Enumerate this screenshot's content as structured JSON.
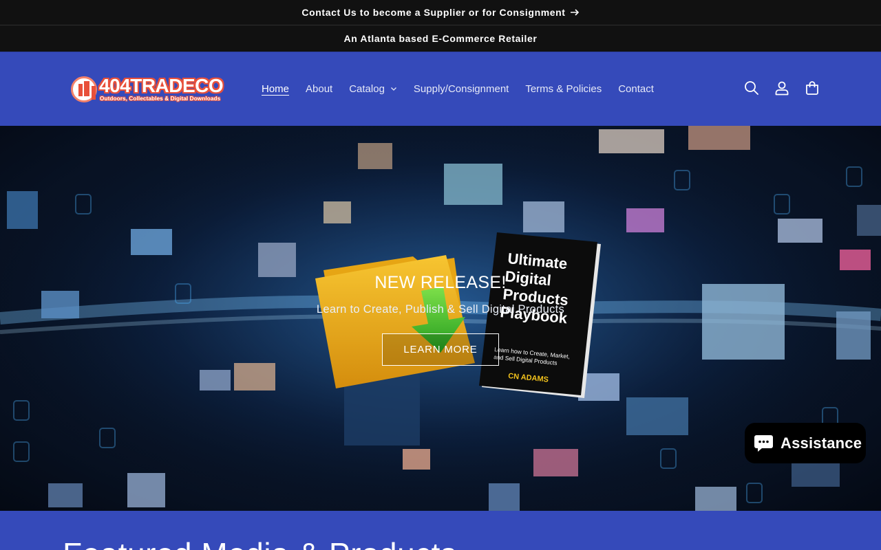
{
  "announcements": {
    "supplier": "Contact Us to become a Supplier or for Consignment",
    "tagline": "An Atlanta based E-Commerce Retailer"
  },
  "logo": {
    "brand": "404TRADECO",
    "tagline": "Outdoors, Collectables & Digital Downloads"
  },
  "nav": {
    "items": [
      {
        "label": "Home",
        "active": true
      },
      {
        "label": "About"
      },
      {
        "label": "Catalog",
        "dropdown": true
      },
      {
        "label": "Supply/Consignment"
      },
      {
        "label": "Terms & Policies"
      },
      {
        "label": "Contact"
      }
    ]
  },
  "header_icons": [
    "search-icon",
    "account-icon",
    "cart-icon"
  ],
  "hero": {
    "title": "NEW RELEASE!",
    "subtitle": "Learn to Create, Publish & Sell Digital Products",
    "button": "LEARN MORE",
    "book": {
      "title_lines": [
        "Ultimate",
        "Digital",
        "Products",
        "Playbook"
      ],
      "subtitle_lines": [
        "Learn how to Create, Market,",
        "and Sell Digital Products"
      ],
      "author": "CN ADAMS"
    }
  },
  "chat": {
    "label": "Assistance"
  },
  "featured": {
    "heading": "Featured Media & Products"
  },
  "colors": {
    "header_bg": "#354aba",
    "announce_bg": "#111111",
    "text": "#ffffff",
    "logo_accent": "#e8503a"
  }
}
